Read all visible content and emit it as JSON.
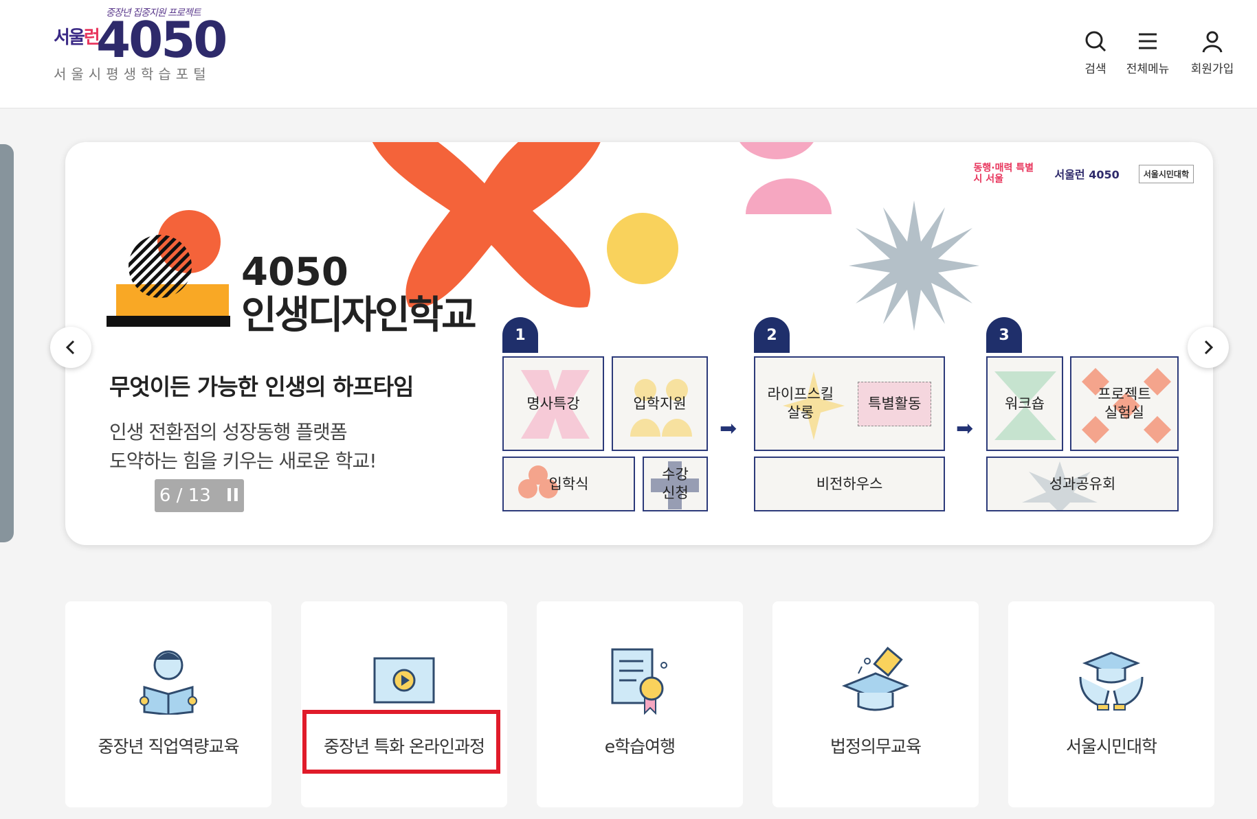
{
  "header": {
    "logo_tagline": "중장년 집중지원 프로젝트",
    "logo_brand_1": "서울",
    "logo_brand_2": "런",
    "logo_num": "4050",
    "logo_sub": "서울시평생학습포털",
    "utils": [
      {
        "label": "검색",
        "icon": "search-icon"
      },
      {
        "label": "전체메뉴",
        "icon": "menu-icon"
      },
      {
        "label": "회원가입",
        "icon": "user-icon"
      }
    ]
  },
  "banner": {
    "title_num": "4050",
    "title": "인생디자인학교",
    "subtitle": "무엇이든 가능한 인생의 하프타임",
    "desc_line1": "인생 전환점의 성장동행 플랫폼",
    "desc_line2": "도약하는 힘을 키우는 새로운 학교!",
    "pager": "6 / 13",
    "pause": "II",
    "partner_logos": [
      "동행·매력 특별시 서울",
      "서울런 4050",
      "서울시민대학"
    ],
    "steps": [
      "1",
      "2",
      "3"
    ],
    "step1": {
      "lecture": "명사특강",
      "support": "입학지원",
      "ceremony": "입학식",
      "enroll": "수강\n신청"
    },
    "step2": {
      "salon": "라이프스킬\n살롱",
      "special": "특별활동",
      "vision": "비전하우스"
    },
    "step3": {
      "workshop": "워크숍",
      "lab": "프로젝트\n실험실",
      "share": "성과공유회"
    }
  },
  "quick_menu": [
    {
      "label": "중장년 직업역량교육",
      "icon": "reading-person-icon"
    },
    {
      "label": "중장년 특화 온라인과정",
      "icon": "video-play-icon"
    },
    {
      "label": "e학습여행",
      "icon": "certificate-icon"
    },
    {
      "label": "법정의무교육",
      "icon": "graduation-cap-icon"
    },
    {
      "label": "서울시민대학",
      "icon": "hands-cap-icon"
    }
  ],
  "colors": {
    "navy": "#1f2f6b",
    "highlight": "#e01b2a",
    "orange": "#f4633a",
    "yellow": "#f9d25c",
    "pink": "#f6a7c1",
    "gray_star": "#b4c0c8"
  }
}
